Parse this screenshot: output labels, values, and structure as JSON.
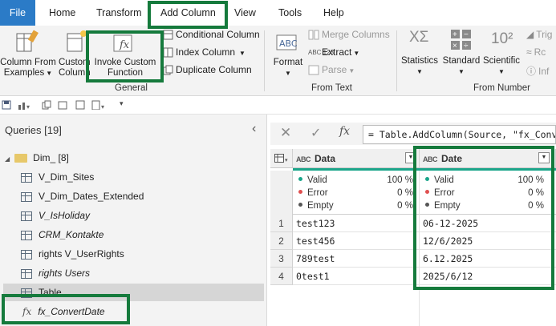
{
  "tabs": [
    "File",
    "Home",
    "Transform",
    "Add Column",
    "View",
    "Tools",
    "Help"
  ],
  "ribbon": {
    "column_from_examples": [
      "Column From",
      "Examples"
    ],
    "custom_column": [
      "Custom",
      "Column"
    ],
    "invoke_custom_function": [
      "Invoke Custom",
      "Function"
    ],
    "conditional_column": "Conditional Column",
    "index_column": "Index Column",
    "duplicate_column": "Duplicate Column",
    "general_label": "General",
    "format": "Format",
    "merge_columns": "Merge Columns",
    "extract": "Extract",
    "parse": "Parse",
    "from_text_label": "From Text",
    "statistics": "Statistics",
    "standard": "Standard",
    "scientific": "Scientific",
    "trig": "Trig",
    "round": "Rc",
    "info": "Inf",
    "from_number_label": "From Number"
  },
  "queries": {
    "header": "Queries [19]",
    "collapse_glyph": "‹",
    "group": "Dim_ [8]",
    "items": [
      {
        "label": "V_Dim_Sites"
      },
      {
        "label": "V_Dim_Dates_Extended"
      },
      {
        "label": "V_IsHoliday"
      },
      {
        "label": "CRM_Kontakte"
      },
      {
        "label": "rights V_UserRights"
      },
      {
        "label": "rights Users"
      },
      {
        "label": "Table"
      },
      {
        "label": "fx_ConvertDate"
      }
    ]
  },
  "formula": {
    "fx": "fx",
    "text": "= Table.AddColumn(Source, \"fx_Conve"
  },
  "grid": {
    "type_label": "ABC",
    "columns": [
      "Data",
      "Date"
    ],
    "quality": [
      {
        "label": "Valid",
        "data": "100 %",
        "date": "100 %",
        "color": "#1aa58a"
      },
      {
        "label": "Error",
        "data": "0 %",
        "date": "0 %",
        "color": "#e05050"
      },
      {
        "label": "Empty",
        "data": "0 %",
        "date": "0 %",
        "color": "#555555"
      }
    ],
    "rows": [
      {
        "n": "1",
        "data": "test123",
        "date": "06-12-2025"
      },
      {
        "n": "2",
        "data": "test456",
        "date": "12/6/2025"
      },
      {
        "n": "3",
        "data": "789test",
        "date": "6.12.2025"
      },
      {
        "n": "4",
        "data": "0test1",
        "date": "2025/6/12"
      }
    ]
  },
  "colors": {
    "file_tab": "#2b7bc7",
    "highlight": "#157a3c",
    "quality_bar": "#1aa58a"
  }
}
